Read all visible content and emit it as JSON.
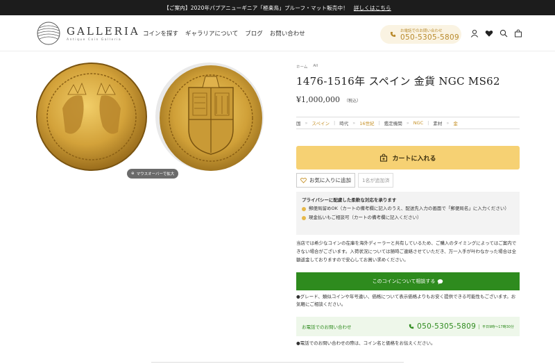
{
  "announcement": {
    "text": "【ご案内】2020年パプアニューギニア「極楽鳥」プルーフ・マット販売中！",
    "link": "詳しくはこちら"
  },
  "header": {
    "logo_name": "GALLERIA",
    "logo_sub": "Antique Coin Galleria",
    "nav": [
      "コインを探す",
      "ギャラリアについて",
      "ブログ",
      "お問い合わせ"
    ],
    "phone_label": "お電話でのお問い合わせ",
    "phone_number": "050-5305-5809",
    "icons": [
      "account-icon",
      "heart-icon",
      "search-icon",
      "cart-icon"
    ]
  },
  "gallery": {
    "zoom_hint": "マウスオーバーで拡大"
  },
  "product": {
    "breadcrumb": [
      "ホーム",
      "All"
    ],
    "title": "1476-1516年 スペイン 金貨 NGC MS62",
    "price": "¥1,000,000",
    "tax": "（税込）",
    "specs": [
      {
        "label": "国",
        "value": "スペイン"
      },
      {
        "label": "時代",
        "value": "16世紀"
      },
      {
        "label": "鑑定機関",
        "value": "NGC"
      },
      {
        "label": "素材",
        "value": "金"
      }
    ],
    "cart_button": "カートに入れる",
    "favorite_button": "お気に入りに追加",
    "favorite_count": "1名が追加済"
  },
  "privacy": {
    "title": "プライバシーに配慮した柔軟な対応を承ります",
    "items": [
      "郵便局留めOK（カートの備考欄に記入のうえ、配送先入力の画面で「郵便局名」に入力ください）",
      "現金払いもご相談可（カートの備考欄に記入ください）"
    ]
  },
  "notice": "当店では希少なコインの在庫を海外ディーラーと共有しているため、ご購入のタイミングによってはご案内できない場合がございます。入荷状況については随時ご連絡させていただき、万一入手が叶わなかった場合は全額返金しておりますので安心してお買い求めください。",
  "consult_button": "このコインについて相談する",
  "grade_note": "●グレード、類似コインや年号違い、価格について表示価格よりもお安く提供できる可能性もございます。お気軽にご相談ください。",
  "phone_box": {
    "label": "お電話でのお問い合わせ",
    "number": "050-5305-5809",
    "hours": "平日9時〜17時30分"
  },
  "call_note": "●電話でのお問い合わせの際は、コイン名と価格をお伝えください。",
  "colors": {
    "gold_accent": "#c59026",
    "cart_button": "#f6d173",
    "consult_green": "#2e8b1e",
    "announcement_bg": "#1c1c1c"
  }
}
